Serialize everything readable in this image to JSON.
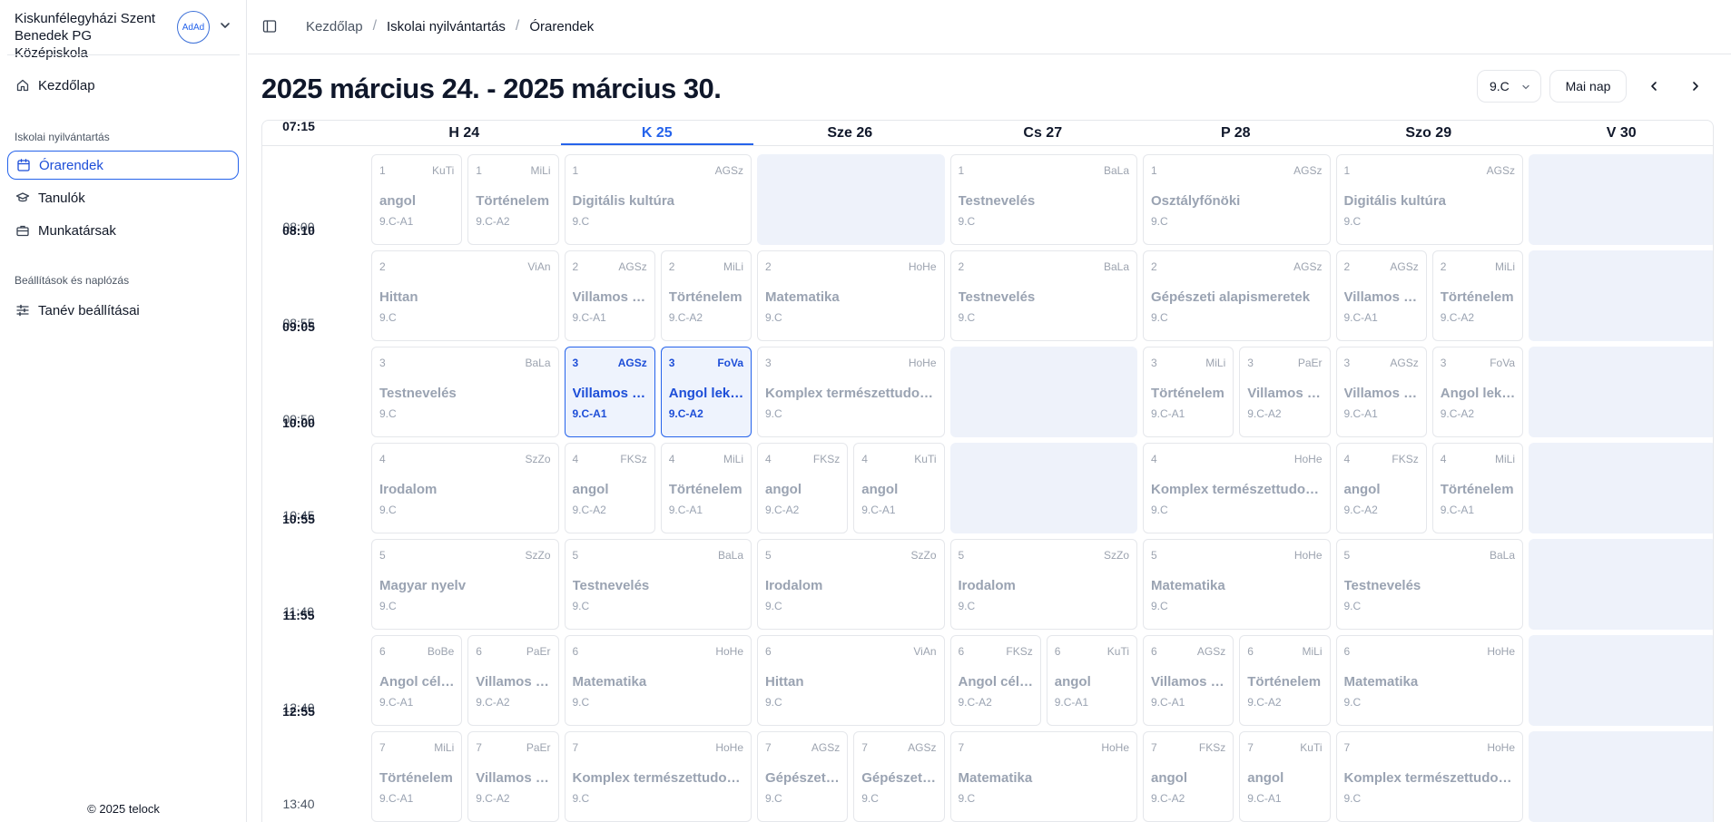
{
  "sidebar": {
    "school_name": "Kiskunfélegyházi Szent Benedek PG Középiskola",
    "avatar_initials": "AdAd",
    "home": "Kezdőlap",
    "section1": "Iskolai nyilvántartás",
    "items": [
      {
        "label": "Órarendek",
        "icon": "calendar-icon",
        "active": true
      },
      {
        "label": "Tanulók",
        "icon": "graduation-cap-icon"
      },
      {
        "label": "Munkatársak",
        "icon": "briefcase-icon"
      }
    ],
    "section2": "Beállítások és naplózás",
    "settings_item": "Tanév beállításai",
    "copyright": "© 2025 telock"
  },
  "breadcrumb": [
    "Kezdőlap",
    "Iskolai nyilvántartás",
    "Órarendek"
  ],
  "page_title": "2025 március 24. - 2025 március 30.",
  "class_select": "9.C",
  "today_button": "Mai nap",
  "accent_color": "#2563eb",
  "days": [
    {
      "label": "H 24"
    },
    {
      "label": "K 25",
      "active": true
    },
    {
      "label": "Sze 26"
    },
    {
      "label": "Cs 27"
    },
    {
      "label": "P 28"
    },
    {
      "label": "Szo 29"
    },
    {
      "label": "V 30"
    }
  ],
  "periods": [
    {
      "start": "07:15",
      "end": "08:00"
    },
    {
      "start": "08:10",
      "end": "08:55"
    },
    {
      "start": "09:05",
      "end": "09:50"
    },
    {
      "start": "10:00",
      "end": "10:45"
    },
    {
      "start": "10:55",
      "end": "11:40"
    },
    {
      "start": "11:55",
      "end": "12:40"
    },
    {
      "start": "12:55",
      "end": "13:40"
    }
  ],
  "grid": [
    [
      [
        {
          "n": "1",
          "t": "KuTi",
          "s": "angol",
          "g": "9.C-A1"
        },
        {
          "n": "1",
          "t": "MiLi",
          "s": "Történelem",
          "g": "9.C-A2"
        }
      ],
      [
        {
          "n": "1",
          "t": "AGSz",
          "s": "Digitális kultúra",
          "g": "9.C"
        }
      ],
      [],
      [
        {
          "n": "1",
          "t": "BaLa",
          "s": "Testnevelés",
          "g": "9.C"
        }
      ],
      [
        {
          "n": "1",
          "t": "AGSz",
          "s": "Osztályfőnöki",
          "g": "9.C"
        }
      ],
      [
        {
          "n": "1",
          "t": "AGSz",
          "s": "Digitális kultúra",
          "g": "9.C"
        }
      ],
      []
    ],
    [
      [
        {
          "n": "2",
          "t": "ViAn",
          "s": "Hittan",
          "g": "9.C"
        }
      ],
      [
        {
          "n": "2",
          "t": "AGSz",
          "s": "Villamos alapismeretek",
          "g": "9.C-A1"
        },
        {
          "n": "2",
          "t": "MiLi",
          "s": "Történelem",
          "g": "9.C-A2"
        }
      ],
      [
        {
          "n": "2",
          "t": "HoHe",
          "s": "Matematika",
          "g": "9.C"
        }
      ],
      [
        {
          "n": "2",
          "t": "BaLa",
          "s": "Testnevelés",
          "g": "9.C"
        }
      ],
      [
        {
          "n": "2",
          "t": "AGSz",
          "s": "Gépészeti alapismeretek",
          "g": "9.C"
        }
      ],
      [
        {
          "n": "2",
          "t": "AGSz",
          "s": "Villamos alapismeretek",
          "g": "9.C-A1"
        },
        {
          "n": "2",
          "t": "MiLi",
          "s": "Történelem",
          "g": "9.C-A2"
        }
      ],
      []
    ],
    [
      [
        {
          "n": "3",
          "t": "BaLa",
          "s": "Testnevelés",
          "g": "9.C"
        }
      ],
      [
        {
          "n": "3",
          "t": "AGSz",
          "s": "Villamos alapismeretek",
          "g": "9.C-A1",
          "hl": true
        },
        {
          "n": "3",
          "t": "FoVa",
          "s": "Angol lektorálás",
          "g": "9.C-A2",
          "hl": true
        }
      ],
      [
        {
          "n": "3",
          "t": "HoHe",
          "s": "Komplex természettudomány",
          "g": "9.C"
        }
      ],
      [],
      [
        {
          "n": "3",
          "t": "MiLi",
          "s": "Történelem",
          "g": "9.C-A1"
        },
        {
          "n": "3",
          "t": "PaEr",
          "s": "Villamos alapismeretek",
          "g": "9.C-A2"
        }
      ],
      [
        {
          "n": "3",
          "t": "AGSz",
          "s": "Villamos alapismeretek",
          "g": "9.C-A1"
        },
        {
          "n": "3",
          "t": "FoVa",
          "s": "Angol lektorálás",
          "g": "9.C-A2"
        }
      ],
      []
    ],
    [
      [
        {
          "n": "4",
          "t": "SzZo",
          "s": "Irodalom",
          "g": "9.C"
        }
      ],
      [
        {
          "n": "4",
          "t": "FKSz",
          "s": "angol",
          "g": "9.C-A2"
        },
        {
          "n": "4",
          "t": "MiLi",
          "s": "Történelem",
          "g": "9.C-A1"
        }
      ],
      [
        {
          "n": "4",
          "t": "FKSz",
          "s": "angol",
          "g": "9.C-A2"
        },
        {
          "n": "4",
          "t": "KuTi",
          "s": "angol",
          "g": "9.C-A1"
        }
      ],
      [],
      [
        {
          "n": "4",
          "t": "HoHe",
          "s": "Komplex természettudomány",
          "g": "9.C"
        }
      ],
      [
        {
          "n": "4",
          "t": "FKSz",
          "s": "angol",
          "g": "9.C-A2"
        },
        {
          "n": "4",
          "t": "MiLi",
          "s": "Történelem",
          "g": "9.C-A1"
        }
      ],
      []
    ],
    [
      [
        {
          "n": "5",
          "t": "SzZo",
          "s": "Magyar nyelv",
          "g": "9.C"
        }
      ],
      [
        {
          "n": "5",
          "t": "BaLa",
          "s": "Testnevelés",
          "g": "9.C"
        }
      ],
      [
        {
          "n": "5",
          "t": "SzZo",
          "s": "Irodalom",
          "g": "9.C"
        }
      ],
      [
        {
          "n": "5",
          "t": "SzZo",
          "s": "Irodalom",
          "g": "9.C"
        }
      ],
      [
        {
          "n": "5",
          "t": "HoHe",
          "s": "Matematika",
          "g": "9.C"
        }
      ],
      [
        {
          "n": "5",
          "t": "BaLa",
          "s": "Testnevelés",
          "g": "9.C"
        }
      ],
      []
    ],
    [
      [
        {
          "n": "6",
          "t": "BoBe",
          "s": "Angol célnyelvi",
          "g": "9.C-A1"
        },
        {
          "n": "6",
          "t": "PaEr",
          "s": "Villamos alapismeretek",
          "g": "9.C-A2"
        }
      ],
      [
        {
          "n": "6",
          "t": "HoHe",
          "s": "Matematika",
          "g": "9.C"
        }
      ],
      [
        {
          "n": "6",
          "t": "ViAn",
          "s": "Hittan",
          "g": "9.C"
        }
      ],
      [
        {
          "n": "6",
          "t": "FKSz",
          "s": "Angol célnyelvi",
          "g": "9.C-A2"
        },
        {
          "n": "6",
          "t": "KuTi",
          "s": "angol",
          "g": "9.C-A1"
        }
      ],
      [
        {
          "n": "6",
          "t": "AGSz",
          "s": "Villamos alapismeretek",
          "g": "9.C-A1"
        },
        {
          "n": "6",
          "t": "MiLi",
          "s": "Történelem",
          "g": "9.C-A2"
        }
      ],
      [
        {
          "n": "6",
          "t": "HoHe",
          "s": "Matematika",
          "g": "9.C"
        }
      ],
      []
    ],
    [
      [
        {
          "n": "7",
          "t": "MiLi",
          "s": "Történelem",
          "g": "9.C-A1"
        },
        {
          "n": "7",
          "t": "PaEr",
          "s": "Villamos alapismeretek",
          "g": "9.C-A2"
        }
      ],
      [
        {
          "n": "7",
          "t": "HoHe",
          "s": "Komplex természettudomány",
          "g": "9.C"
        }
      ],
      [
        {
          "n": "7",
          "t": "AGSz",
          "s": "Gépészeti alapismeretek",
          "g": "9.C"
        },
        {
          "n": "7",
          "t": "AGSz",
          "s": "Gépészeti alapismeretek",
          "g": "9.C"
        }
      ],
      [
        {
          "n": "7",
          "t": "HoHe",
          "s": "Matematika",
          "g": "9.C"
        }
      ],
      [
        {
          "n": "7",
          "t": "FKSz",
          "s": "angol",
          "g": "9.C-A2"
        },
        {
          "n": "7",
          "t": "KuTi",
          "s": "angol",
          "g": "9.C-A1"
        }
      ],
      [
        {
          "n": "7",
          "t": "HoHe",
          "s": "Komplex természettudomány",
          "g": "9.C"
        }
      ],
      []
    ]
  ]
}
